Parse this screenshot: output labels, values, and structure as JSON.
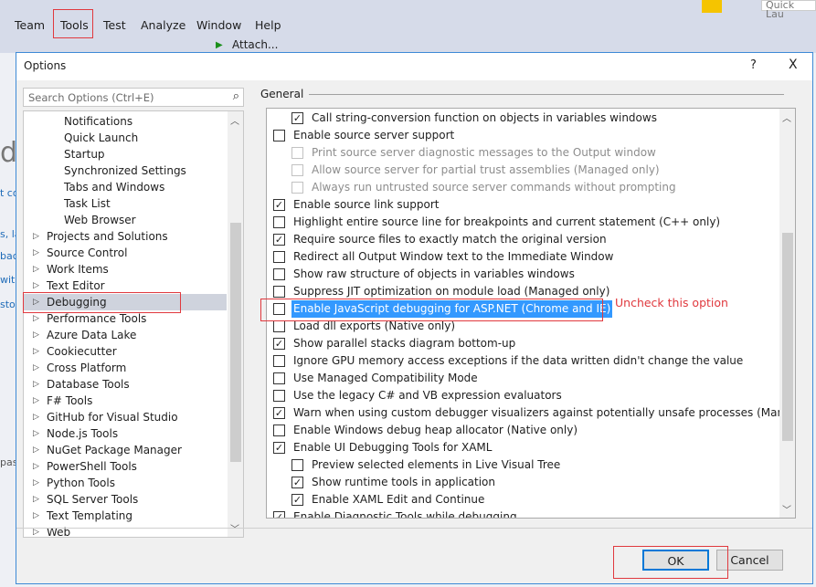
{
  "menubar": {
    "items": [
      "Team",
      "Tools",
      "Test",
      "Analyze",
      "Window",
      "Help"
    ],
    "quick_launch": "Quick Lau"
  },
  "toolbar": {
    "attach": "Attach..."
  },
  "background_fragments": [
    "d",
    "t co",
    "s, la",
    "bac",
    "wit",
    "sto",
    "pass"
  ],
  "dialog": {
    "title": "Options",
    "help": "?",
    "close": "X",
    "search_placeholder": "Search Options (Ctrl+E)",
    "tree": [
      {
        "label": "Notifications",
        "level": 2
      },
      {
        "label": "Quick Launch",
        "level": 2
      },
      {
        "label": "Startup",
        "level": 2
      },
      {
        "label": "Synchronized Settings",
        "level": 2
      },
      {
        "label": "Tabs and Windows",
        "level": 2
      },
      {
        "label": "Task List",
        "level": 2
      },
      {
        "label": "Web Browser",
        "level": 2
      },
      {
        "label": "Projects and Solutions",
        "level": 1
      },
      {
        "label": "Source Control",
        "level": 1
      },
      {
        "label": "Work Items",
        "level": 1
      },
      {
        "label": "Text Editor",
        "level": 1
      },
      {
        "label": "Debugging",
        "level": 1,
        "selected": true
      },
      {
        "label": "Performance Tools",
        "level": 1
      },
      {
        "label": "Azure Data Lake",
        "level": 1
      },
      {
        "label": "Cookiecutter",
        "level": 1
      },
      {
        "label": "Cross Platform",
        "level": 1
      },
      {
        "label": "Database Tools",
        "level": 1
      },
      {
        "label": "F# Tools",
        "level": 1
      },
      {
        "label": "GitHub for Visual Studio",
        "level": 1
      },
      {
        "label": "Node.js Tools",
        "level": 1
      },
      {
        "label": "NuGet Package Manager",
        "level": 1
      },
      {
        "label": "PowerShell Tools",
        "level": 1
      },
      {
        "label": "Python Tools",
        "level": 1
      },
      {
        "label": "SQL Server Tools",
        "level": 1
      },
      {
        "label": "Text Templating",
        "level": 1
      },
      {
        "label": "Web",
        "level": 1
      }
    ],
    "section": "General",
    "options": [
      {
        "label": "Call string-conversion function on objects in variables windows",
        "checked": true,
        "indent": 1
      },
      {
        "label": "Enable source server support",
        "checked": false,
        "indent": 0
      },
      {
        "label": "Print source server diagnostic messages to the Output window",
        "checked": false,
        "indent": 1,
        "disabled": true
      },
      {
        "label": "Allow source server for partial trust assemblies (Managed only)",
        "checked": false,
        "indent": 1,
        "disabled": true
      },
      {
        "label": "Always run untrusted source server commands without prompting",
        "checked": false,
        "indent": 1,
        "disabled": true
      },
      {
        "label": "Enable source link support",
        "checked": true,
        "indent": 0
      },
      {
        "label": "Highlight entire source line for breakpoints and current statement (C++ only)",
        "checked": false,
        "indent": 0
      },
      {
        "label": "Require source files to exactly match the original version",
        "checked": true,
        "indent": 0
      },
      {
        "label": "Redirect all Output Window text to the Immediate Window",
        "checked": false,
        "indent": 0
      },
      {
        "label": "Show raw structure of objects in variables windows",
        "checked": false,
        "indent": 0
      },
      {
        "label": "Suppress JIT optimization on module load (Managed only)",
        "checked": false,
        "indent": 0
      },
      {
        "label": "Enable JavaScript debugging for ASP.NET (Chrome and IE)",
        "checked": false,
        "indent": 0,
        "selected": true
      },
      {
        "label": "Load dll exports (Native only)",
        "checked": false,
        "indent": 0
      },
      {
        "label": "Show parallel stacks diagram bottom-up",
        "checked": true,
        "indent": 0
      },
      {
        "label": "Ignore GPU memory access exceptions if the data written didn't change the value",
        "checked": false,
        "indent": 0
      },
      {
        "label": "Use Managed Compatibility Mode",
        "checked": false,
        "indent": 0
      },
      {
        "label": "Use the legacy C# and VB expression evaluators",
        "checked": false,
        "indent": 0
      },
      {
        "label": "Warn when using custom debugger visualizers against potentially unsafe processes (Managed only)",
        "checked": true,
        "indent": 0
      },
      {
        "label": "Enable Windows debug heap allocator (Native only)",
        "checked": false,
        "indent": 0
      },
      {
        "label": "Enable UI Debugging Tools for XAML",
        "checked": true,
        "indent": 0
      },
      {
        "label": "Preview selected elements in Live Visual Tree",
        "checked": false,
        "indent": 1
      },
      {
        "label": "Show runtime tools in application",
        "checked": true,
        "indent": 1
      },
      {
        "label": "Enable XAML Edit and Continue",
        "checked": true,
        "indent": 1
      },
      {
        "label": "Enable Diagnostic Tools while debugging",
        "checked": true,
        "indent": 0
      }
    ],
    "ok": "OK",
    "cancel": "Cancel"
  },
  "annotation": {
    "text": "Uncheck this option",
    "color": "#e0393e"
  }
}
